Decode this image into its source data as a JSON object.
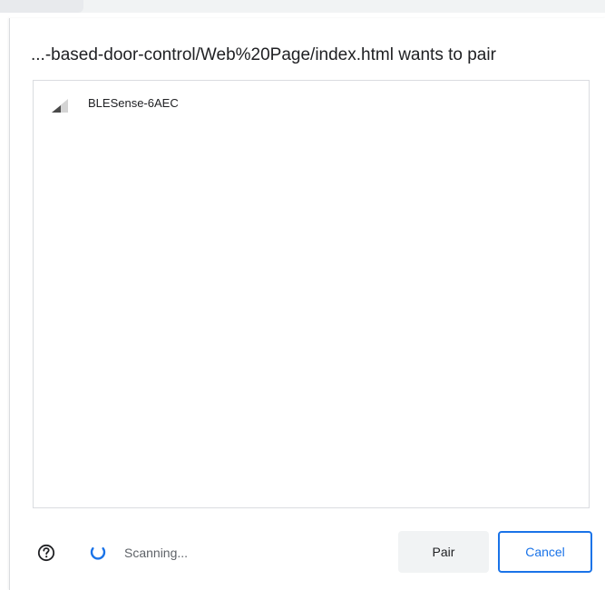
{
  "dialog": {
    "title": "...-based-door-control/Web%20Page/index.html wants to pair"
  },
  "devices": [
    {
      "name": "BLESense-6AEC",
      "icon": "signal-strength-icon"
    }
  ],
  "footer": {
    "help_icon": "help-circle-icon",
    "spinner_icon": "loading-spinner-icon",
    "status_text": "Scanning...",
    "pair_label": "Pair",
    "cancel_label": "Cancel"
  },
  "colors": {
    "accent": "#1a73e8",
    "text": "#202124",
    "secondary_text": "#5f6368",
    "border": "#dadce0",
    "button_bg": "#f1f3f4"
  }
}
